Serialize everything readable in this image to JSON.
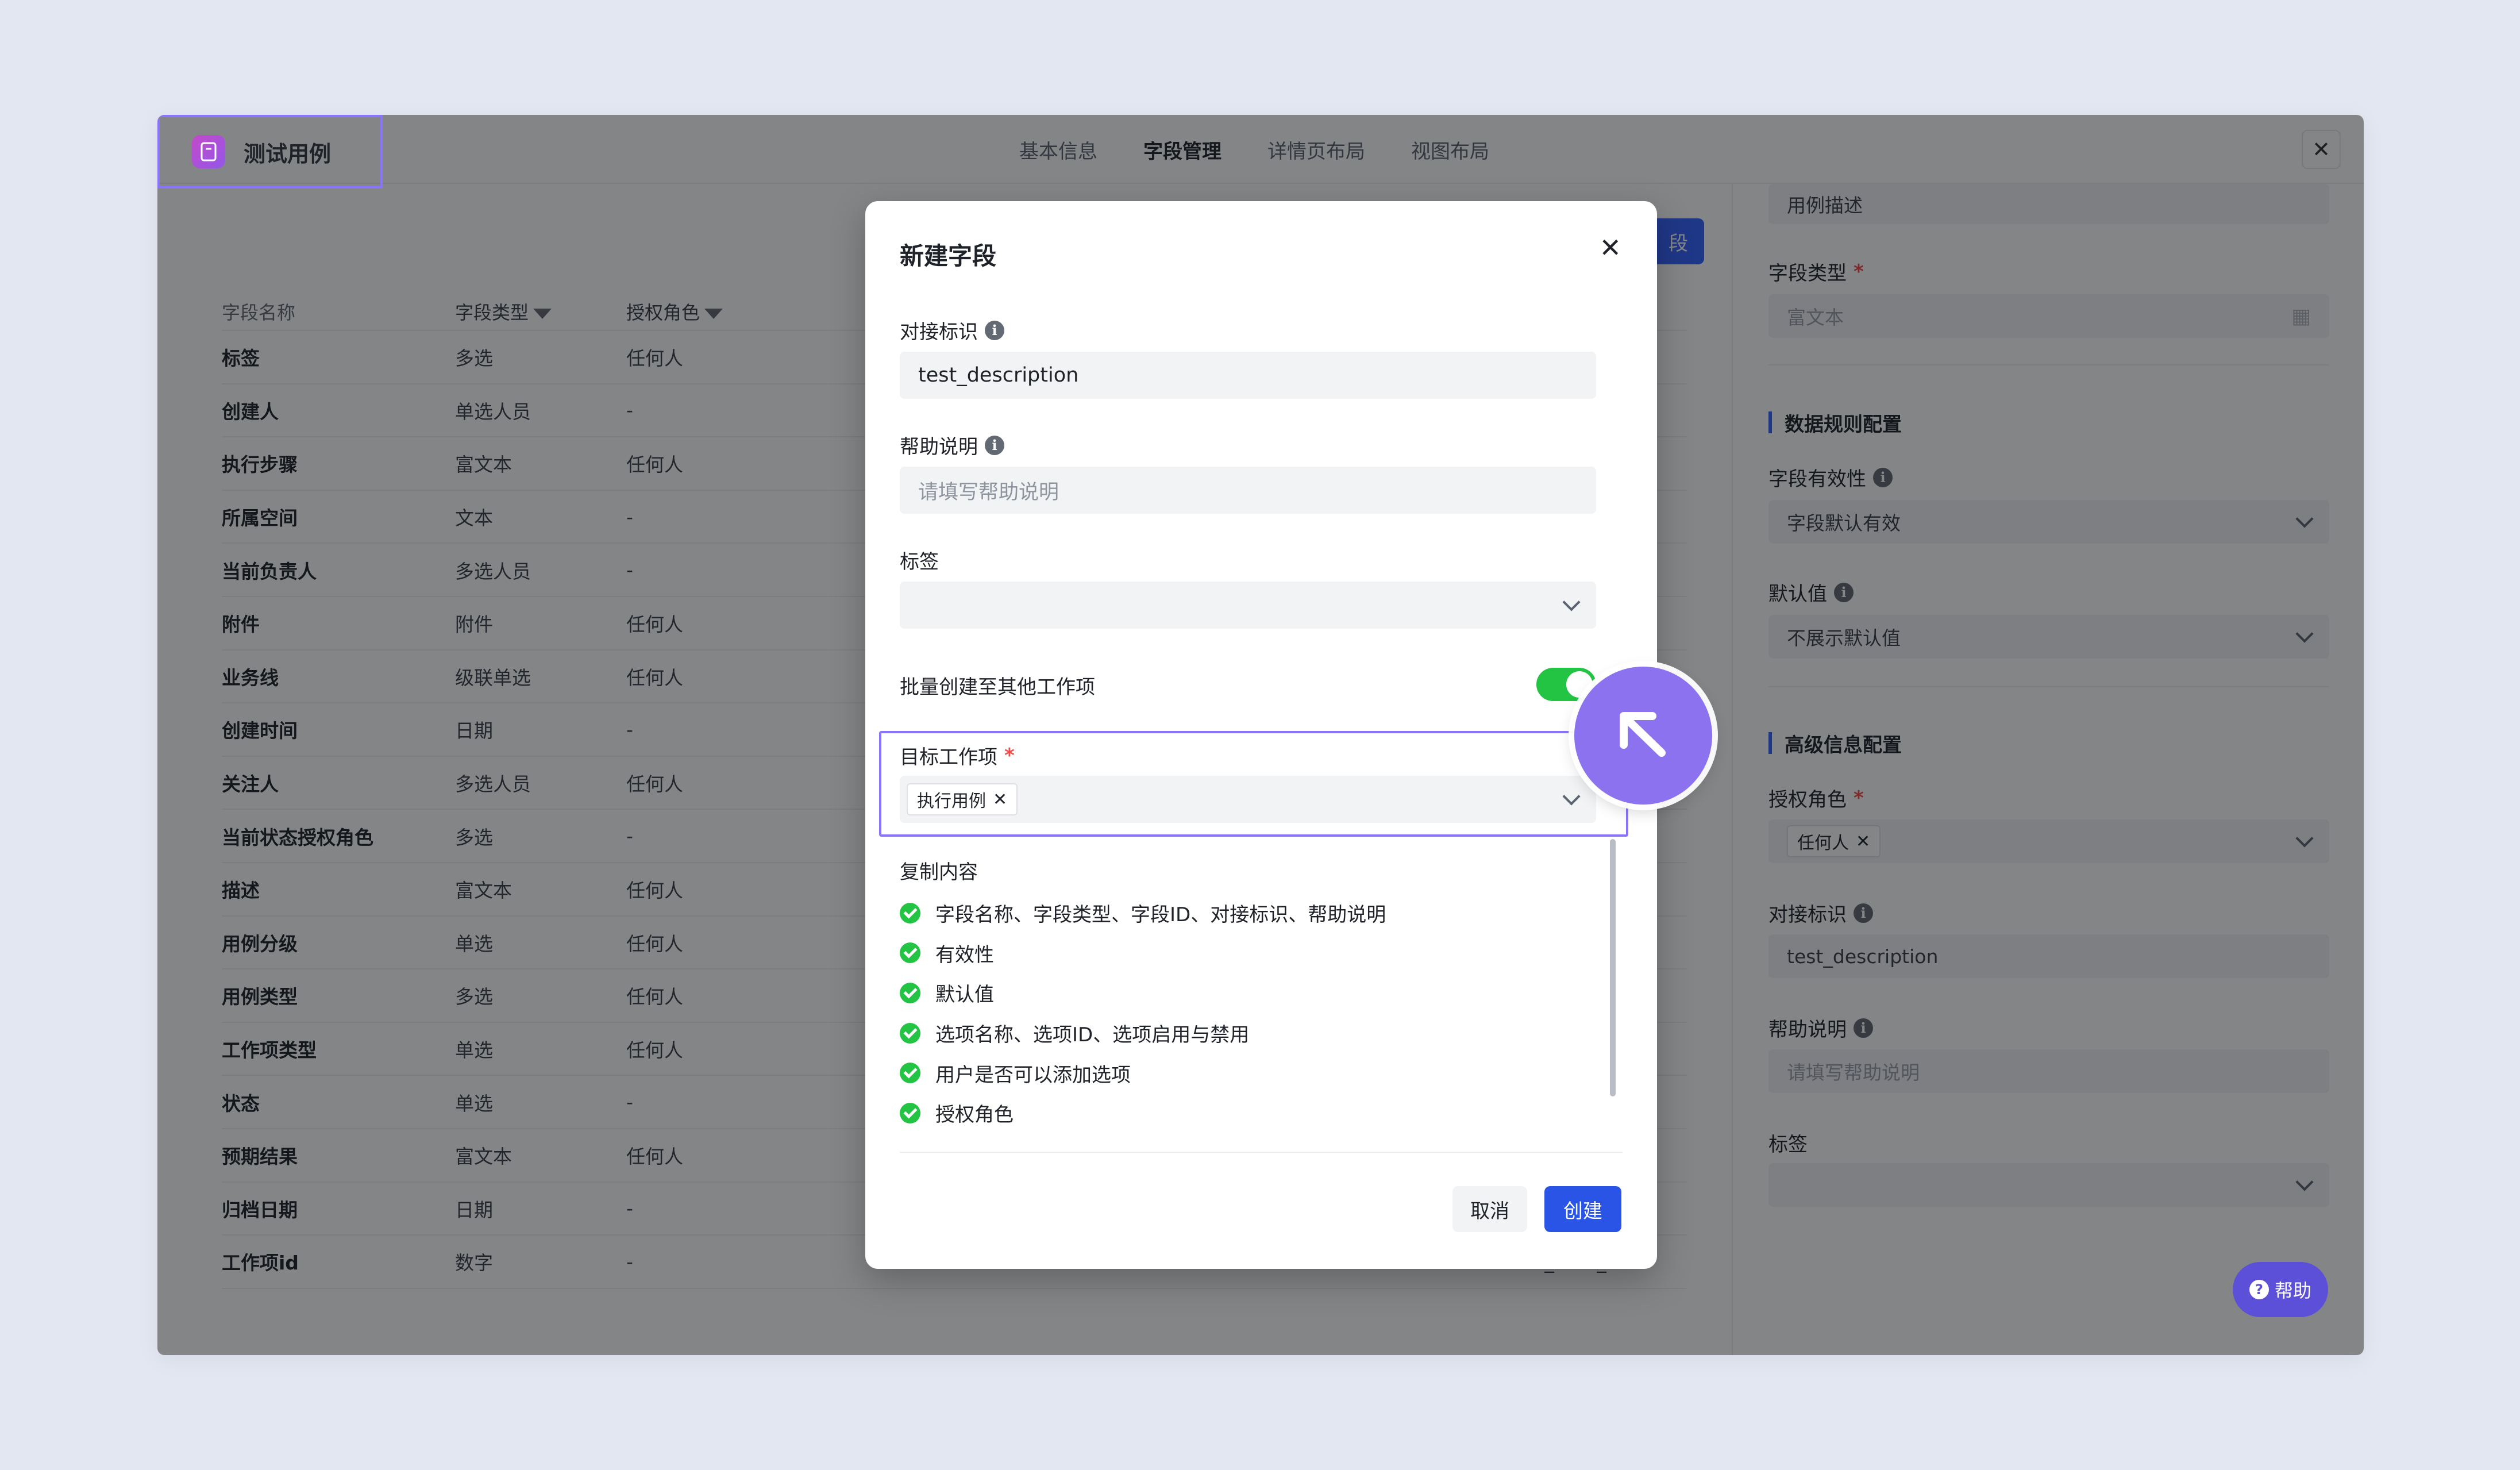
{
  "app": {
    "title": "测试用例",
    "tabs": [
      "基本信息",
      "字段管理",
      "详情页布局",
      "视图布局"
    ],
    "active_tab": "字段管理",
    "close_icon": "close-icon"
  },
  "table": {
    "headers": [
      "字段名称",
      "字段类型",
      "授权角色"
    ],
    "add_button_label": "段",
    "rows": [
      {
        "name": "标签",
        "type": "多选",
        "role": "任何人"
      },
      {
        "name": "创建人",
        "type": "单选人员",
        "role": "-"
      },
      {
        "name": "执行步骤",
        "type": "富文本",
        "role": "任何人"
      },
      {
        "name": "所属空间",
        "type": "文本",
        "role": "-"
      },
      {
        "name": "当前负责人",
        "type": "多选人员",
        "role": "-"
      },
      {
        "name": "附件",
        "type": "附件",
        "role": "任何人"
      },
      {
        "name": "业务线",
        "type": "级联单选",
        "role": "任何人"
      },
      {
        "name": "创建时间",
        "type": "日期",
        "role": "-"
      },
      {
        "name": "关注人",
        "type": "多选人员",
        "role": "任何人"
      },
      {
        "name": "当前状态授权角色",
        "type": "多选",
        "role": "-"
      },
      {
        "name": "描述",
        "type": "富文本",
        "role": "任何人"
      },
      {
        "name": "用例分级",
        "type": "单选",
        "role": "任何人"
      },
      {
        "name": "用例类型",
        "type": "多选",
        "role": "任何人"
      },
      {
        "name": "工作项类型",
        "type": "单选",
        "role": "任何人"
      },
      {
        "name": "状态",
        "type": "单选",
        "role": "-"
      },
      {
        "name": "预期结果",
        "type": "富文本",
        "role": "任何人"
      },
      {
        "name": "归档日期",
        "type": "日期",
        "role": "-"
      },
      {
        "name": "工作项id",
        "type": "数字",
        "role": "-",
        "key": "work_item_id"
      }
    ]
  },
  "right_panel": {
    "name_value": "用例描述",
    "field_type_label": "字段类型",
    "field_type_value": "富文本",
    "data_rules_title": "数据规则配置",
    "validity_label": "字段有效性",
    "validity_value": "字段默认有效",
    "default_label": "默认值",
    "default_value": "不展示默认值",
    "advanced_title": "高级信息配置",
    "roles_label": "授权角色",
    "roles_tag": "任何人",
    "key_label": "对接标识",
    "key_value": "test_description",
    "help_label": "帮助说明",
    "help_placeholder": "请填写帮助说明",
    "tags_label": "标签",
    "help_button": "帮助"
  },
  "modal": {
    "title": "新建字段",
    "key_label": "对接标识",
    "key_value": "test_description",
    "help_label": "帮助说明",
    "help_placeholder": "请填写帮助说明",
    "tags_label": "标签",
    "batch_label": "批量创建至其他工作项",
    "batch_enabled": true,
    "target_label": "目标工作项",
    "target_tag": "执行用例",
    "copy_label": "复制内容",
    "copy_items": [
      "字段名称、字段类型、字段ID、对接标识、帮助说明",
      "有效性",
      "默认值",
      "选项名称、选项ID、选项启用与禁用",
      "用户是否可以添加选项",
      "授权角色"
    ],
    "cancel_label": "取消",
    "create_label": "创建"
  },
  "colors": {
    "primary": "#2954e6",
    "accent_purple": "#8d72f0",
    "toggle_green": "#23c343",
    "required_red": "#f54a45"
  }
}
